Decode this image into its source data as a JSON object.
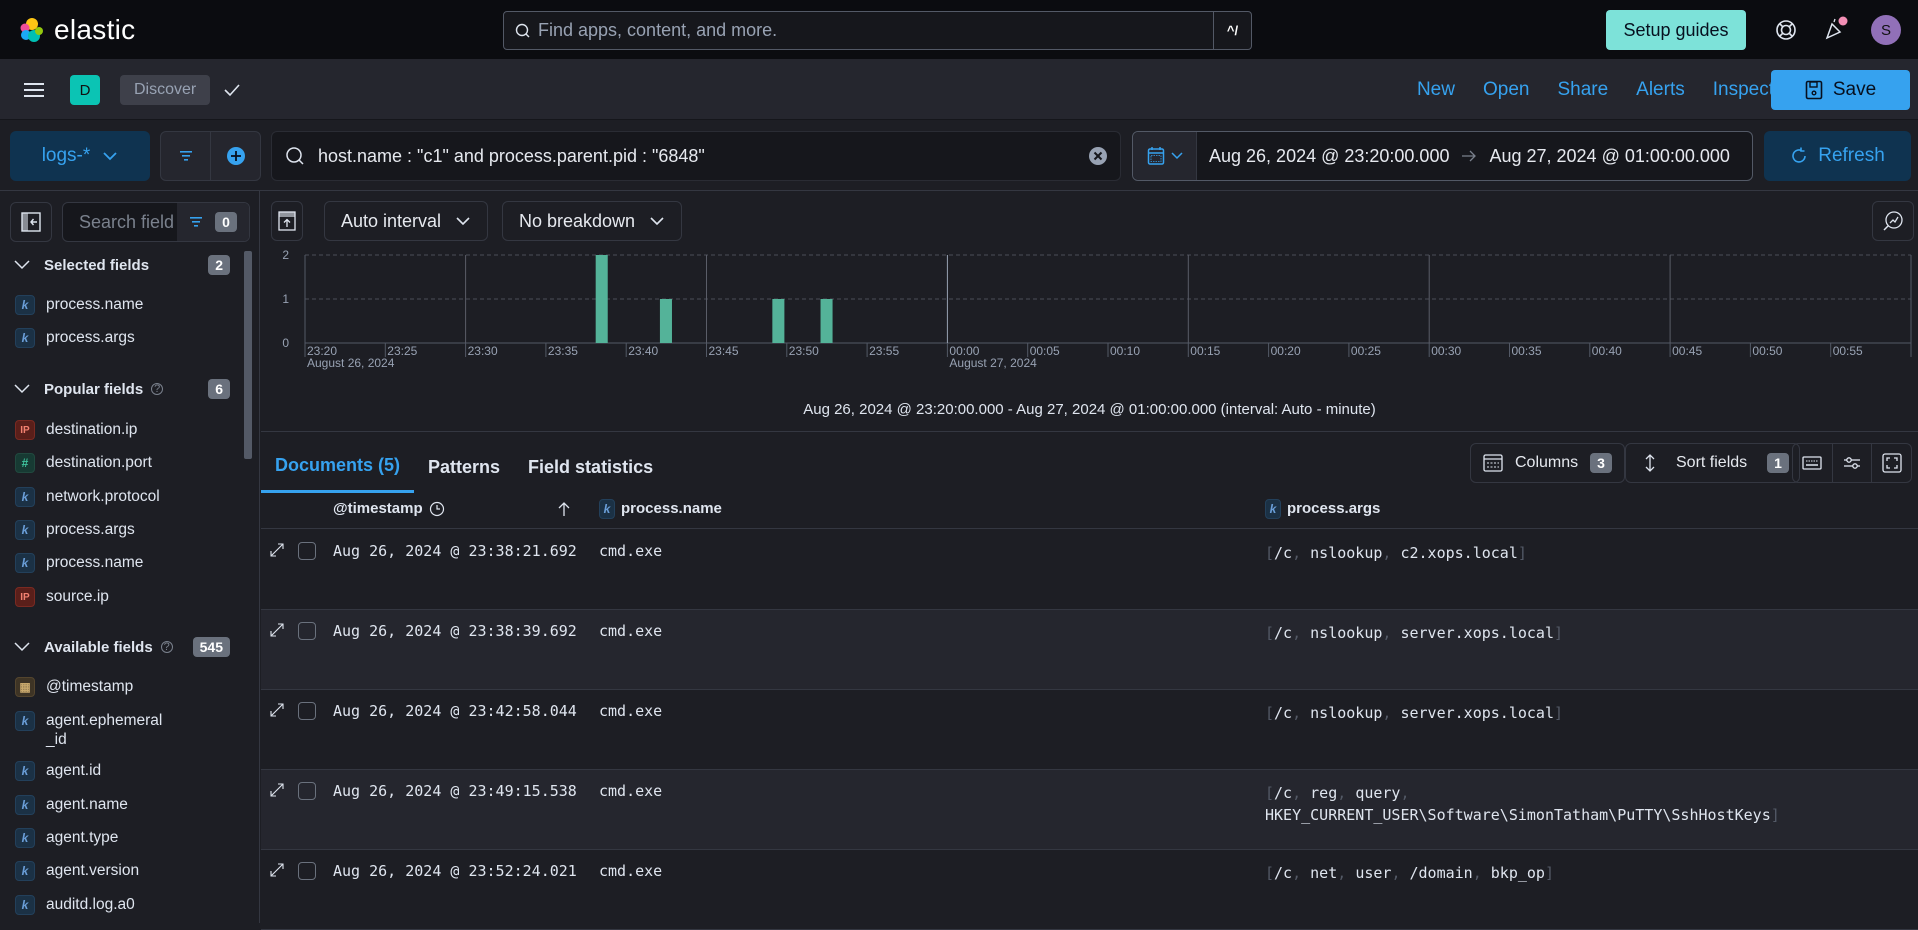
{
  "header": {
    "brand": "elastic",
    "search_placeholder": "Find apps, content, and more.",
    "search_shortcut": "^/",
    "setup_guides": "Setup guides",
    "avatar_initial": "S"
  },
  "appbar": {
    "app_badge": "D",
    "breadcrumb": "Discover",
    "links": [
      "New",
      "Open",
      "Share",
      "Alerts",
      "Inspect"
    ],
    "save_label": "Save"
  },
  "querybar": {
    "data_view": "logs-*",
    "query": "host.name : \"c1\" and process.parent.pid : \"6848\"",
    "start_date": "Aug 26, 2024 @ 23:20:00.000",
    "end_date": "Aug 27, 2024 @ 01:00:00.000",
    "refresh_label": "Refresh"
  },
  "sidebar": {
    "search_placeholder": "Search field names",
    "filter_count": "0",
    "selected": {
      "title": "Selected fields",
      "count": "2",
      "fields": [
        {
          "type": "k",
          "name": "process.name"
        },
        {
          "type": "k",
          "name": "process.args"
        }
      ]
    },
    "popular": {
      "title": "Popular fields",
      "count": "6",
      "fields": [
        {
          "type": "ip",
          "name": "destination.ip"
        },
        {
          "type": "#",
          "name": "destination.port"
        },
        {
          "type": "k",
          "name": "network.protocol"
        },
        {
          "type": "k",
          "name": "process.args"
        },
        {
          "type": "k",
          "name": "process.name"
        },
        {
          "type": "ip",
          "name": "source.ip"
        }
      ]
    },
    "available": {
      "title": "Available fields",
      "count": "545",
      "fields": [
        {
          "type": "date",
          "name": "@timestamp"
        },
        {
          "type": "k",
          "name": "agent.ephemeral_id"
        },
        {
          "type": "k",
          "name": "agent.id"
        },
        {
          "type": "k",
          "name": "agent.name"
        },
        {
          "type": "k",
          "name": "agent.type"
        },
        {
          "type": "k",
          "name": "agent.version"
        },
        {
          "type": "k",
          "name": "auditd.log.a0"
        }
      ]
    }
  },
  "toolbar": {
    "interval": "Auto interval",
    "breakdown": "No breakdown"
  },
  "chart_data": {
    "type": "bar",
    "title": "",
    "xlabel": "",
    "ylabel": "",
    "ylim": [
      0,
      2
    ],
    "y_ticks": [
      "0",
      "1",
      "2"
    ],
    "x_ticks": [
      "23:20",
      "23:25",
      "23:30",
      "23:35",
      "23:40",
      "23:45",
      "23:50",
      "23:55",
      "00:00",
      "00:05",
      "00:10",
      "00:15",
      "00:20",
      "00:25",
      "00:30",
      "00:35",
      "00:40",
      "00:45",
      "00:50",
      "00:55"
    ],
    "x_date_labels": [
      {
        "at": "23:20",
        "label": "August 26, 2024"
      },
      {
        "at": "00:00",
        "label": "August 27, 2024"
      }
    ],
    "x_range_minutes": [
      0,
      100
    ],
    "bars": [
      {
        "minute": "23:38",
        "value": 2
      },
      {
        "minute": "23:42",
        "value": 1
      },
      {
        "minute": "23:49",
        "value": 1
      },
      {
        "minute": "23:52",
        "value": 1
      }
    ],
    "bar_color": "#54b399",
    "grid": true,
    "caption": "Aug 26, 2024 @ 23:20:00.000 - Aug 27, 2024 @ 01:00:00.000 (interval: Auto - minute)"
  },
  "tabs": [
    {
      "label": "Documents (5)",
      "active": true
    },
    {
      "label": "Patterns",
      "active": false
    },
    {
      "label": "Field statistics",
      "active": false
    }
  ],
  "grid_toolbar": {
    "columns_label": "Columns",
    "columns_count": "3",
    "sort_label": "Sort fields",
    "sort_count": "1"
  },
  "grid": {
    "headers": [
      "@timestamp",
      "process.name",
      "process.args"
    ],
    "rows": [
      {
        "timestamp": "Aug 26, 2024 @ 23:38:21.692",
        "process_name": "cmd.exe",
        "args": [
          "/c",
          "nslookup",
          "c2.xops.local"
        ]
      },
      {
        "timestamp": "Aug 26, 2024 @ 23:38:39.692",
        "process_name": "cmd.exe",
        "args": [
          "/c",
          "nslookup",
          "server.xops.local"
        ]
      },
      {
        "timestamp": "Aug 26, 2024 @ 23:42:58.044",
        "process_name": "cmd.exe",
        "args": [
          "/c",
          "nslookup",
          "server.xops.local"
        ]
      },
      {
        "timestamp": "Aug 26, 2024 @ 23:49:15.538",
        "process_name": "cmd.exe",
        "args": [
          "/c",
          "reg",
          "query",
          "HKEY_CURRENT_USER\\Software\\SimonTatham\\PuTTY\\SshHostKeys"
        ]
      },
      {
        "timestamp": "Aug 26, 2024 @ 23:52:24.021",
        "process_name": "cmd.exe",
        "args": [
          "/c",
          "net",
          "user",
          "/domain",
          "bkp_op"
        ]
      }
    ]
  }
}
